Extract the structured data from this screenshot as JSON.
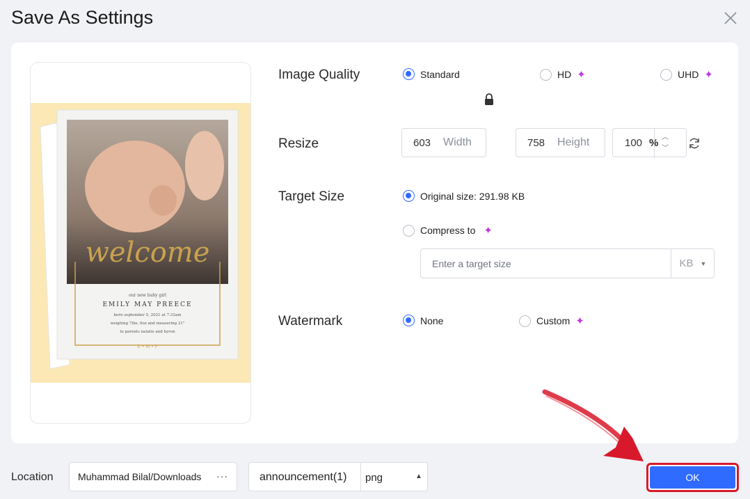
{
  "dialog": {
    "title": "Save As Settings"
  },
  "preview": {
    "card_line1": "our new baby girl",
    "card_name": "EMILY MAY PREECE",
    "card_line2": "born september 5, 2021 at 7:32am",
    "card_line3": "weighing 7lbs, 6oz and measuring 21\"",
    "card_line4": "to parents natalie and byron",
    "card_initials": "E • M • P",
    "card_script": "welcome"
  },
  "image_quality": {
    "label": "Image Quality",
    "options": [
      {
        "label": "Standard",
        "selected": true,
        "premium": false
      },
      {
        "label": "HD",
        "selected": false,
        "premium": true
      },
      {
        "label": "UHD",
        "selected": false,
        "premium": true
      }
    ]
  },
  "resize": {
    "label": "Resize",
    "width_value": "603",
    "width_placeholder": "Width",
    "height_value": "758",
    "height_placeholder": "Height",
    "percent_value": "100",
    "percent_unit": "%"
  },
  "target_size": {
    "label": "Target Size",
    "original_label": "Original size: 291.98 KB",
    "compress_label": "Compress to",
    "input_placeholder": "Enter a target size",
    "unit": "KB"
  },
  "watermark": {
    "label": "Watermark",
    "none_label": "None",
    "custom_label": "Custom"
  },
  "footer": {
    "location_label": "Location",
    "location_value": "Muhammad Bilal/Downloads",
    "location_more": "···",
    "filename": "announcement(1)",
    "extension": "png",
    "ok_label": "OK"
  },
  "colors": {
    "accent": "#2f6bff",
    "premium": "#c036e0",
    "highlight": "#d8192c",
    "preview_bg": "#fbe8b4"
  }
}
